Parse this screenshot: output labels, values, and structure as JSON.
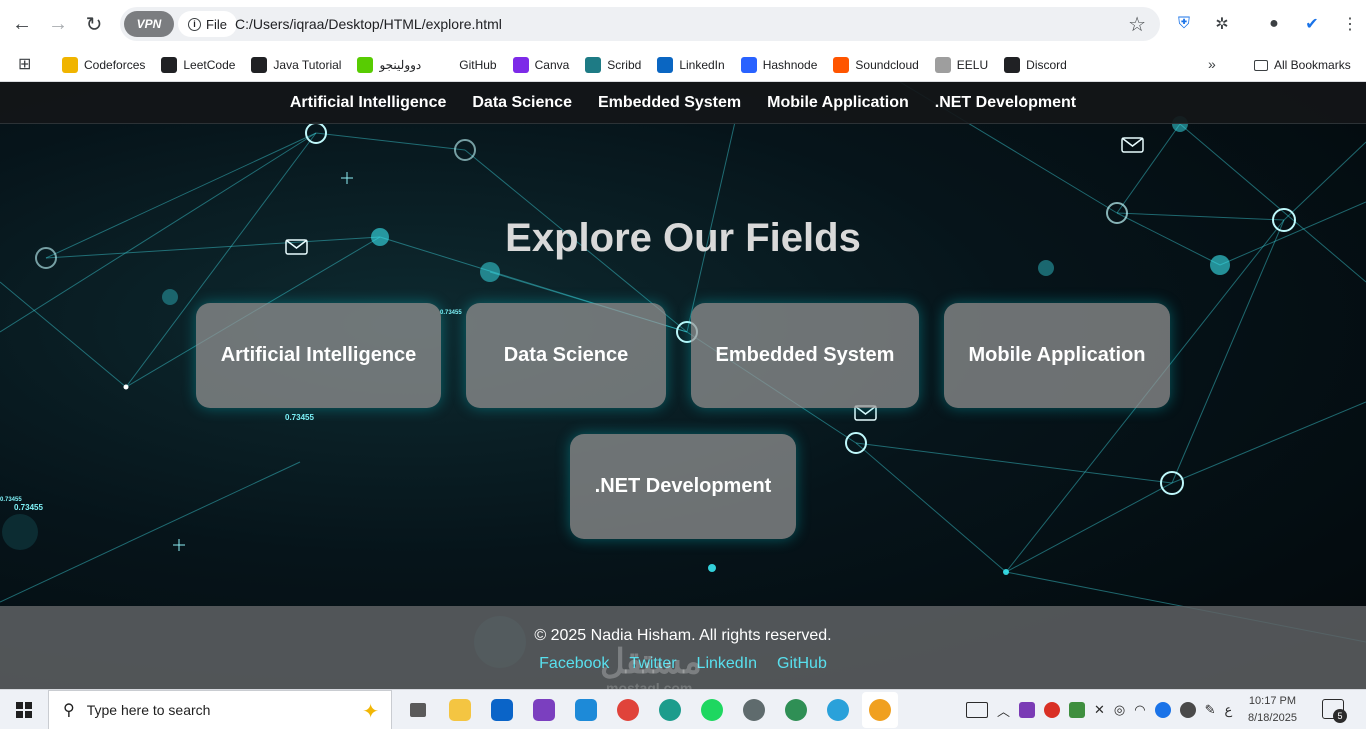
{
  "browser": {
    "vpn_label": "VPN",
    "file_label": "File",
    "url": "C:/Users/iqraa/Desktop/HTML/explore.html",
    "bookmarks": [
      {
        "label": "Codeforces",
        "color": "#f0b400"
      },
      {
        "label": "LeetCode",
        "color": "#202124"
      },
      {
        "label": "Java Tutorial",
        "color": "#202124"
      },
      {
        "label": "دوولينجو",
        "color": "#58cc02"
      },
      {
        "label": "GitHub",
        "color": "#ffffff"
      },
      {
        "label": "Canva",
        "color": "#7d2ae8"
      },
      {
        "label": "Scribd",
        "color": "#1e7b85"
      },
      {
        "label": "LinkedIn",
        "color": "#0a66c2"
      },
      {
        "label": "Hashnode",
        "color": "#2962ff"
      },
      {
        "label": "Soundcloud",
        "color": "#ff5500"
      },
      {
        "label": "EELU",
        "color": "#9e9e9e"
      },
      {
        "label": "Discord",
        "color": "#202124"
      }
    ],
    "all_bookmarks_label": "All Bookmarks"
  },
  "site": {
    "nav": [
      "Artificial Intelligence",
      "Data Science",
      "Embedded System",
      "Mobile Application",
      ".NET Development"
    ],
    "title": "Explore Our Fields",
    "cards": [
      "Artificial Intelligence",
      "Data Science",
      "Embedded System",
      "Mobile Application",
      ".NET Development"
    ],
    "footer": {
      "copyright": "© 2025 Nadia Hisham. All rights reserved.",
      "links": [
        "Facebook",
        "Twitter",
        "LinkedIn",
        "GitHub"
      ]
    },
    "bg_numbers": [
      "0.73455",
      "0.73455",
      "0.73455",
      "0.73455"
    ],
    "watermark": "مستقل",
    "watermark_sub": "mostaql.com"
  },
  "taskbar": {
    "search_placeholder": "Type here to search",
    "time": "10:17 PM",
    "date": "8/18/2025",
    "notif_count": "5",
    "lang": "ع"
  },
  "colors": {
    "accent_cyan": "#58e0ee",
    "card_bg": "#969696",
    "nav_bg": "#141618"
  }
}
